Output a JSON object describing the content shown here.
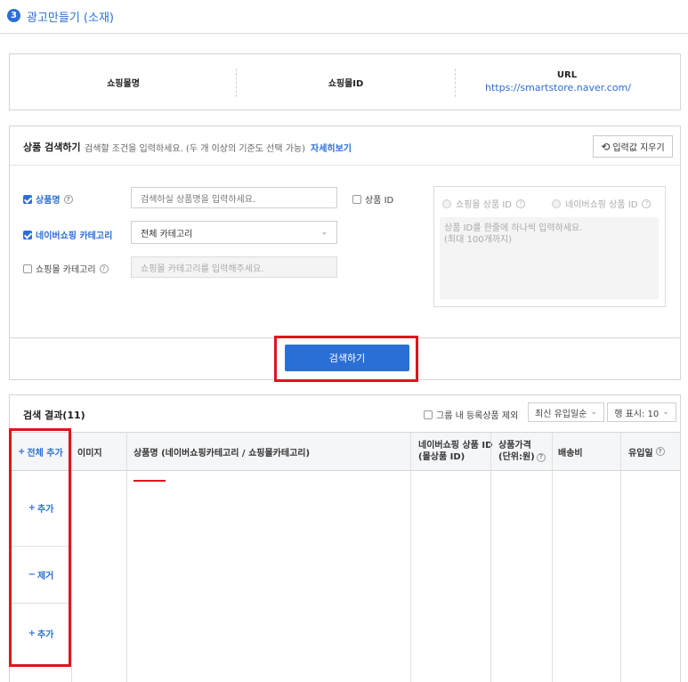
{
  "header": {
    "step": "3",
    "title": "광고만들기 (소재)"
  },
  "shop_info": {
    "name_label": "쇼핑몰명",
    "id_label": "쇼핑몰ID",
    "url_label": "URL",
    "url_value": "https://smartstore.naver.com/"
  },
  "search": {
    "title": "상품 검색하기",
    "description": "검색할 조건을 입력하세요. (두 개 이상의 기준도 선택 가능)",
    "detail_link": "자세히보기",
    "reset_label": "입력값 지우기",
    "product_name_label": "상품명",
    "product_name_placeholder": "검색하실 상품명을 입력하세요.",
    "product_id_label": "상품 ID",
    "naver_category_label": "네이버쇼핑 카테고리",
    "naver_category_value": "전체 카테고리",
    "mall_category_label": "쇼핑몰 카테고리",
    "mall_category_placeholder": "쇼핑몰 카테고리를 입력해주세요.",
    "mall_product_id_label": "쇼핑몰 상품 ID",
    "naver_product_id_label": "네이버쇼핑 상품 ID",
    "id_textarea_line1": "상품 ID를 한줄에 하나씩 입력하세요.",
    "id_textarea_line2": "(최대 100개까지)",
    "submit_label": "검색하기"
  },
  "results": {
    "title": "검색 결과(11)",
    "exclude_label": "그룹 내 등록상품 제외",
    "sort_value": "최신 유입일순",
    "rows_value": "행 표시: 10",
    "columns": {
      "add_all": "전체 추가",
      "image": "이미지",
      "product": "상품명 (네이버쇼핑카테고리 / 쇼핑몰카테고리)",
      "naver_id_line1": "네이버쇼핑 상품 ID",
      "naver_id_line2": "(몰상품 ID)",
      "price_line1": "상품가격",
      "price_line2": "(단위:원)",
      "shipping": "배송비",
      "inflow": "유입일"
    },
    "row_actions": [
      {
        "symbol": "+",
        "label": "추가"
      },
      {
        "symbol": "−",
        "label": "제거"
      },
      {
        "symbol": "+",
        "label": "추가"
      }
    ]
  },
  "colors": {
    "accent": "#2b6fd6",
    "highlight": "#e0141e"
  }
}
